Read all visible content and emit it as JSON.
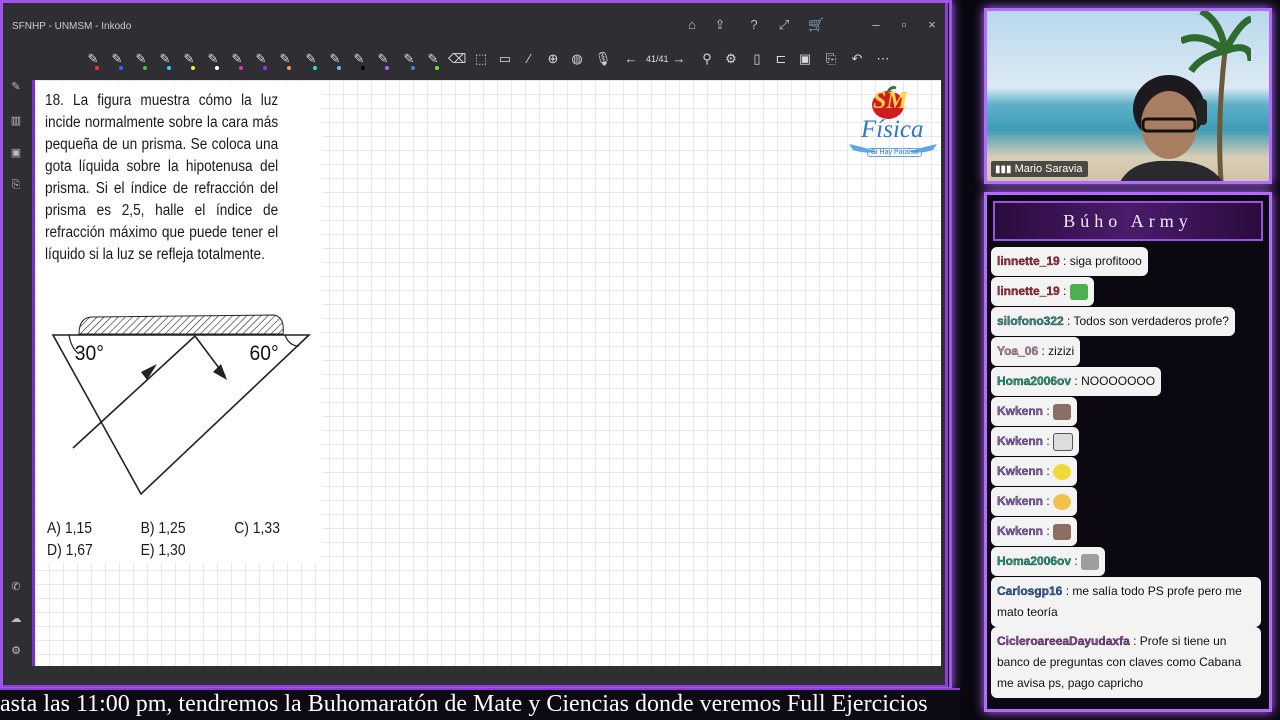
{
  "window": {
    "title": "SFNHP - UNMSM - Inkodo",
    "page_indicator": "41/41"
  },
  "problem": {
    "number": "18.",
    "text": "La figura muestra cómo la luz incide normalmente sobre la cara más pequeña de un prisma. Se coloca una gota líquida sobre la hipotenusa del prisma. Si el índice de refracción del prisma es 2,5, halle el índice de refracción máximo que puede tener el líquido si la luz se refleja totalmente.",
    "angle_left": "30°",
    "angle_right": "60°",
    "options": [
      {
        "label": "A) 1,15"
      },
      {
        "label": "B) 1,25"
      },
      {
        "label": "C) 1,33"
      },
      {
        "label": "D) 1,67"
      },
      {
        "label": "E) 1,30"
      }
    ]
  },
  "logo": {
    "mark": "SM",
    "name": "Física",
    "tagline": "Sí Hay Paraíso"
  },
  "webcam": {
    "name": "Mario Saravia"
  },
  "chat": {
    "title": "Búho Army",
    "messages": [
      {
        "user": "linnette_19",
        "text": "siga profitooo",
        "user_color": "#b0283a"
      },
      {
        "user": "linnette_19",
        "text": "",
        "user_color": "#b0283a",
        "emote": "frog"
      },
      {
        "user": "silofono322",
        "text": "Todos son verdaderos profe?",
        "user_color": "#2e8f8a"
      },
      {
        "user": "Yoa_06",
        "text": "zizizi",
        "user_color": "#c98ab0"
      },
      {
        "user": "Homa2006ov",
        "text": "NOOOOOOO",
        "user_color": "#1f9e7a"
      },
      {
        "user": "Kwkenn",
        "text": "",
        "user_color": "#8a5fb8",
        "emote": "cat"
      },
      {
        "user": "Kwkenn",
        "text": "",
        "user_color": "#8a5fb8",
        "emote": "dog"
      },
      {
        "user": "Kwkenn",
        "text": "",
        "user_color": "#8a5fb8",
        "emote": "face"
      },
      {
        "user": "Kwkenn",
        "text": "",
        "user_color": "#8a5fb8",
        "emote": "think"
      },
      {
        "user": "Kwkenn",
        "text": "",
        "user_color": "#8a5fb8",
        "emote": "cat"
      },
      {
        "user": "Homa2006ov",
        "text": "",
        "user_color": "#1f9e7a",
        "emote": "cat2"
      },
      {
        "user": "Carlosgp16",
        "text": "me salía todo PS profe pero me mato teoría",
        "user_color": "#2f5fa8"
      },
      {
        "user": "CicleroareeaDayudaxfa",
        "text": "Profe si tiene un banco de preguntas con claves como Cabana me avisa ps, pago capricho",
        "user_color": "#8a3f9a"
      }
    ]
  },
  "ticker": {
    "text": "asta las 11:00 pm, tendremos la Buhomaratón de Mate y Ciencias donde veremos Full Ejercicios"
  },
  "colors": {
    "frame": "#b36bff",
    "canvas_grid": "#e7e7ee"
  }
}
